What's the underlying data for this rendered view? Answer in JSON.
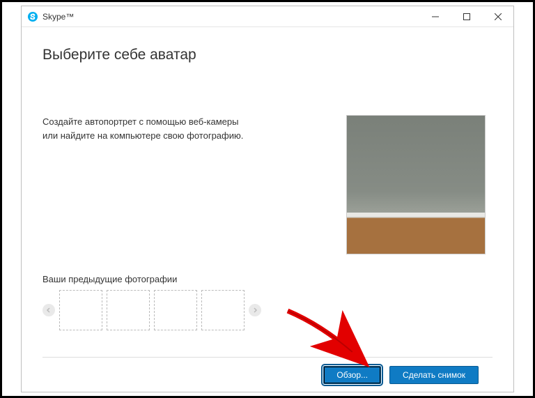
{
  "window": {
    "title": "Skype™"
  },
  "heading": "Выберите себе аватар",
  "instructions": "Создайте автопортрет с помощью веб-камеры или найдите на компьютере свою фотографию.",
  "previous_label": "Ваши предыдущие фотографии",
  "buttons": {
    "browse": "Обзор...",
    "take_snapshot": "Сделать снимок"
  }
}
